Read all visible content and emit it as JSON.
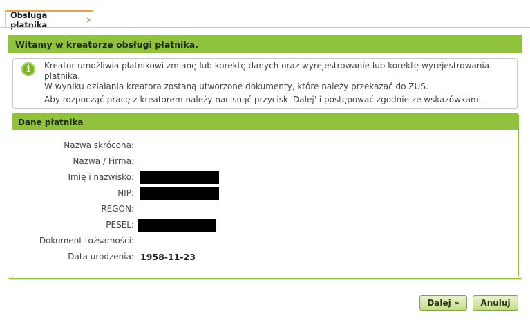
{
  "tab": {
    "label": "Obsługa płatnika",
    "close_glyph": "×"
  },
  "panel": {
    "title": "Witamy w kreatorze obsługi płatnika.",
    "info": {
      "icon": "info-icon",
      "line1": "Kreator umożliwia płatnikowi zmianę lub korektę danych oraz wyrejestrowanie lub korektę wyrejestrowania płatnika.",
      "line2": "W wyniku działania kreatora zostaną utworzone dokumenty, które należy przekazać do ZUS.",
      "line3": "Aby rozpocząć pracę z kreatorem należy nacisnąć przycisk 'Dalej' i postępować zgodnie ze wskazówkami."
    }
  },
  "dane": {
    "title": "Dane płatnika",
    "fields": {
      "nazwa_skrocona": {
        "label": "Nazwa skrócona:",
        "value": ""
      },
      "nazwa_firma": {
        "label": "Nazwa / Firma:",
        "value": ""
      },
      "imie_nazwisko": {
        "label": "Imię i nazwisko:",
        "value": ""
      },
      "nip": {
        "label": "NIP:",
        "value": ""
      },
      "regon": {
        "label": "REGON:",
        "value": ""
      },
      "pesel": {
        "label": "PESEL:",
        "value": ""
      },
      "dokument": {
        "label": "Dokument tożsamości:",
        "value": ""
      },
      "data_urodzenia": {
        "label": "Data urodzenia:",
        "value": "1958-11-23"
      }
    }
  },
  "buttons": {
    "next": "Dalej »",
    "cancel": "Anuluj"
  },
  "colors": {
    "accent_green": "#90c23e",
    "tab_accent": "#e6a04f"
  }
}
